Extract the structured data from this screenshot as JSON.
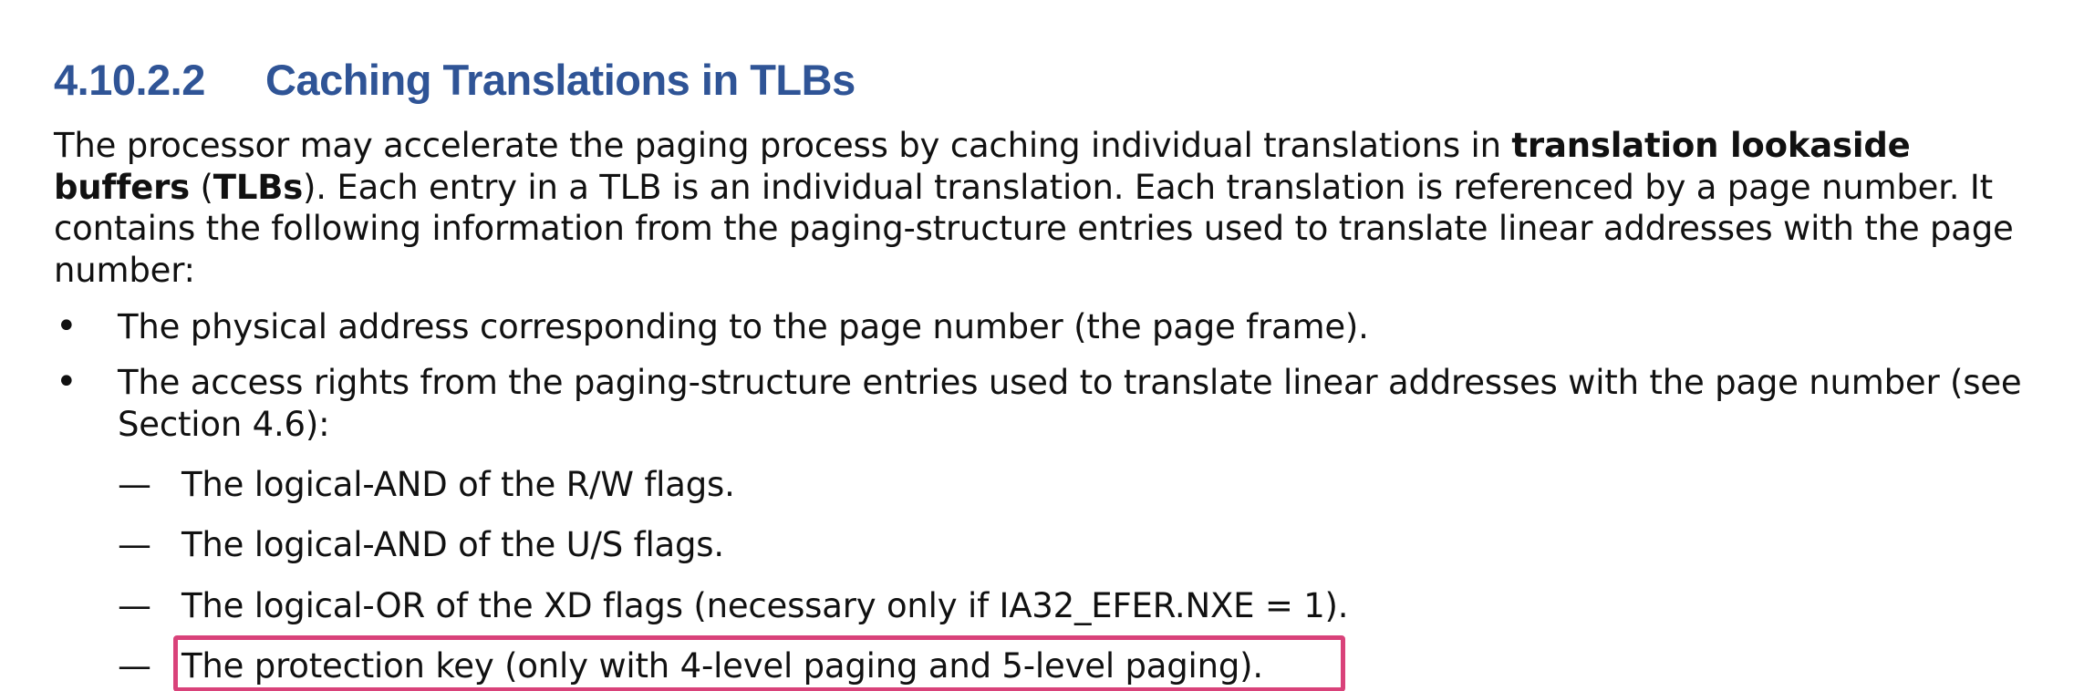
{
  "section": {
    "number": "4.10.2.2",
    "title": "Caching Translations in TLBs"
  },
  "paragraph": {
    "part1": "The processor may accelerate the paging process by caching individual translations in ",
    "bold1": "translation lookaside buffers",
    "part2": " (",
    "bold2": "TLBs",
    "part3": "). Each entry in a TLB is an individual translation. Each translation is referenced by a page number. It contains the following information from the paging-structure entries used to translate linear addresses with the page number:"
  },
  "bullets": [
    {
      "marker": "•",
      "text": "The physical address corresponding to the page number (the page frame)."
    },
    {
      "marker": "•",
      "text": "The access rights from the paging-structure entries used to translate linear addresses with the page number (see Section 4.6):"
    }
  ],
  "sub_items": [
    {
      "marker": "—",
      "text": "The logical-AND of the R/W flags."
    },
    {
      "marker": "—",
      "text": "The logical-AND of the U/S flags."
    },
    {
      "marker": "—",
      "text": "The logical-OR of the XD flags (necessary only if IA32_EFER.NXE = 1)."
    },
    {
      "marker": "—",
      "text": "The protection key (only with 4-level paging and 5-level paging)."
    }
  ],
  "colors": {
    "heading": "#2f5496",
    "highlight_border": "#d9427a",
    "text": "#111111"
  }
}
